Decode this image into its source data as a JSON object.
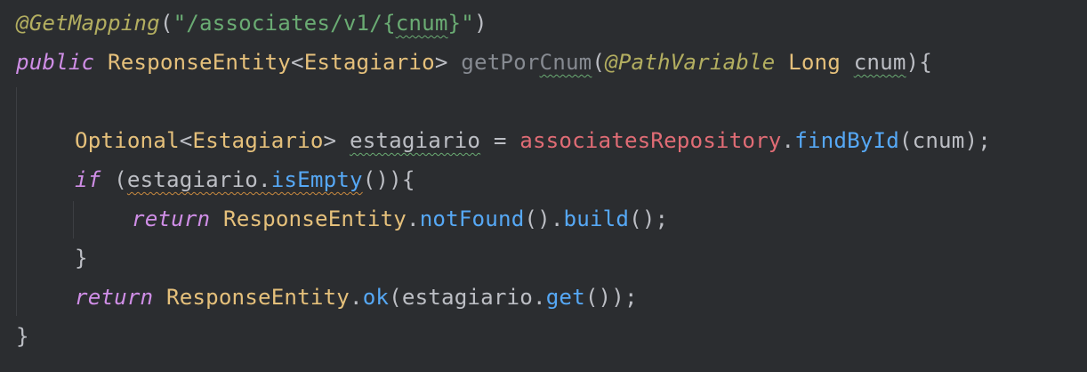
{
  "code": {
    "line1": {
      "annotation": "@GetMapping",
      "open_paren": "(",
      "str_a": "\"/associates/v1/",
      "brace_open": "{",
      "path_var": "cnum",
      "brace_close": "}",
      "str_b": "\"",
      "close_paren": ")"
    },
    "line2": {
      "kw_public": "public",
      "type_response": "ResponseEntity",
      "lt": "<",
      "type_estagiario": "Estagiario",
      "gt": ">",
      "method_name_a": "getPor",
      "method_name_b": "Cnum",
      "open_paren": "(",
      "ann_pathvar": "@PathVariable",
      "type_long": "Long",
      "param": "cnum",
      "close": "){"
    },
    "line4": {
      "type_optional": "Optional",
      "lt": "<",
      "type_estagiario": "Estagiario",
      "gt": ">",
      "var": "estagiario",
      "eq": " = ",
      "field": "associatesRepository",
      "dot": ".",
      "method": "findById",
      "args": "(cnum);"
    },
    "line5": {
      "kw_if": "if",
      "open": " (",
      "var": "estagiario",
      "dot": ".",
      "method": "isEmpty",
      "close": "()){"
    },
    "line6": {
      "kw_return": "return",
      "type": "ResponseEntity",
      "dot1": ".",
      "method1": "notFound",
      "mid": "().",
      "method2": "build",
      "end": "();"
    },
    "line7": {
      "brace": "}"
    },
    "line8": {
      "kw_return": "return",
      "type": "ResponseEntity",
      "dot1": ".",
      "method1": "ok",
      "open": "(estagiario.",
      "method2": "get",
      "end": "());"
    },
    "line9": {
      "brace": "}"
    }
  },
  "colors": {
    "background": "#2b2d30",
    "annotation": "#b3ae60",
    "keyword": "#cf8ee6",
    "type": "#e5c07b",
    "string": "#6aab73",
    "field": "#e06c75",
    "method": "#56a8f5",
    "plain": "#bcbec4",
    "unused_method": "#868a91"
  }
}
